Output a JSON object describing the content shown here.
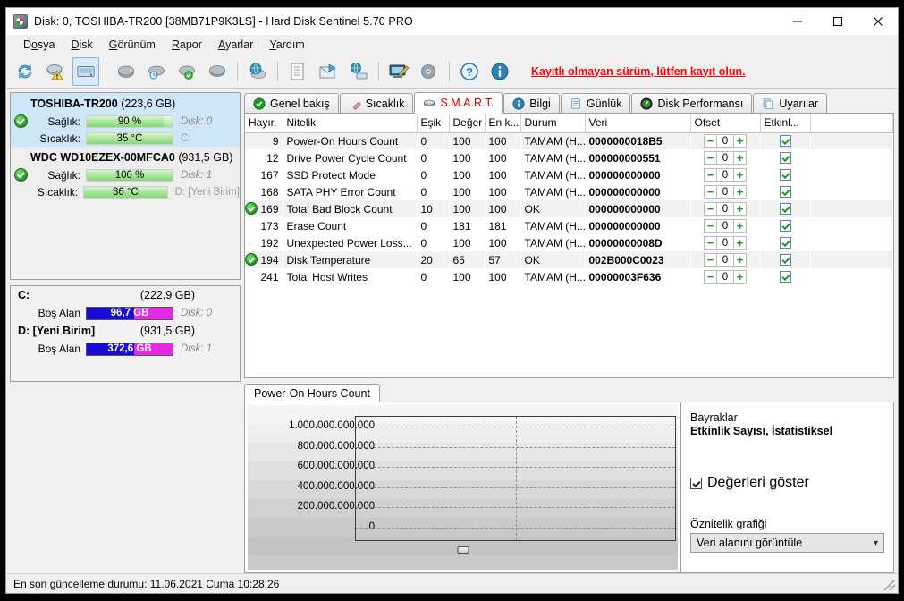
{
  "window": {
    "title": "Disk: 0, TOSHIBA-TR200 [38MB71P9K3LS]  -  Hard Disk Sentinel 5.70 PRO",
    "app_icon": "hard-disk-sentinel-icon",
    "minimize": "–",
    "maximize": "□",
    "close": "✕"
  },
  "menu": [
    {
      "label": "Dosya",
      "accel_index": 1
    },
    {
      "label": "Disk",
      "accel_index": 0
    },
    {
      "label": "Görünüm",
      "accel_index": 0
    },
    {
      "label": "Rapor",
      "accel_index": 0
    },
    {
      "label": "Ayarlar",
      "accel_index": 0
    },
    {
      "label": "Yardım",
      "accel_index": 0
    }
  ],
  "toolbar": {
    "buttons": [
      {
        "name": "refresh-icon"
      },
      {
        "name": "alert-disk-icon"
      },
      {
        "name": "disk-overview-icon",
        "selected": true
      },
      {
        "name": "disk-remove-icon"
      },
      {
        "name": "disk-clock-icon"
      },
      {
        "name": "disk-ok-icon"
      },
      {
        "name": "disk-cloud-icon"
      },
      {
        "name": "disk-globe-icon"
      },
      {
        "name": "report-icon"
      },
      {
        "name": "send-report-icon"
      },
      {
        "name": "network-disk-icon"
      },
      {
        "name": "configure-icon"
      },
      {
        "name": "disk-stack-icon"
      },
      {
        "name": "help-icon"
      },
      {
        "name": "info-icon"
      }
    ],
    "register_link": "Kayıtlı olmayan sürüm, lütfen kayıt olun.",
    "register_link_color": "#ff0000"
  },
  "sidebar": {
    "disks": [
      {
        "model": "TOSHIBA-TR200",
        "capacity": "(223,6 GB)",
        "selected": true,
        "status_icon": "green-check-icon",
        "health_label": "Sağlık:",
        "health_value": "90 %",
        "health_percent": 90,
        "temp_label": "Sıcaklık:",
        "temp_value": "35 °C",
        "temp_percent": 100,
        "disk_id": "Disk: 0",
        "drive_letters": "C:"
      },
      {
        "model": "WDC WD10EZEX-00MFCA0",
        "capacity": "(931,5 GB)",
        "selected": false,
        "status_icon": "green-check-icon",
        "health_label": "Sağlık:",
        "health_value": "100 %",
        "health_percent": 100,
        "temp_label": "Sıcaklık:",
        "temp_value": "36 °C",
        "temp_percent": 100,
        "disk_id": "Disk: 1",
        "drive_letters": "D: [Yeni Birim]"
      }
    ],
    "volumes": [
      {
        "letter": "C:",
        "capacity": "(222,9 GB)",
        "free_label": "Boş Alan",
        "free_value": "96,7 GB",
        "free_percent": 43,
        "disk_id": "Disk: 0"
      },
      {
        "letter": "D: [Yeni Birim]",
        "capacity": "(931,5 GB)",
        "free_label": "Boş Alan",
        "free_value": "372,6 GB",
        "free_percent": 40,
        "disk_id": "Disk: 1"
      }
    ]
  },
  "tabs": [
    {
      "label": "Genel bakış",
      "icon": "green-check-icon",
      "active": false
    },
    {
      "label": "Sıcaklık",
      "icon": "thermometer-icon",
      "active": false
    },
    {
      "label": "S.M.A.R.T.",
      "icon": "smart-chip-icon",
      "active": true
    },
    {
      "label": "Bilgi",
      "icon": "info-icon",
      "active": false
    },
    {
      "label": "Günlük",
      "icon": "log-page-icon",
      "active": false
    },
    {
      "label": "Disk Performansı",
      "icon": "gauge-icon",
      "active": false
    },
    {
      "label": "Uyarılar",
      "icon": "copy-pages-icon",
      "active": false
    }
  ],
  "smart_table": {
    "columns": [
      "Hayır.",
      "Nitelik",
      "Eşik",
      "Değer",
      "En k...",
      "Durum",
      "Veri",
      "Ofset",
      "Etkinl..."
    ],
    "rows": [
      {
        "id": "9",
        "attribute": "Power-On Hours Count",
        "threshold": "0",
        "value": "100",
        "worst": "100",
        "status": "TAMAM (H...",
        "data": "0000000018B5",
        "offset": "0",
        "enabled": true,
        "ok_icon": false
      },
      {
        "id": "12",
        "attribute": "Drive Power Cycle Count",
        "threshold": "0",
        "value": "100",
        "worst": "100",
        "status": "TAMAM (H...",
        "data": "000000000551",
        "offset": "0",
        "enabled": true,
        "ok_icon": false
      },
      {
        "id": "167",
        "attribute": "SSD Protect Mode",
        "threshold": "0",
        "value": "100",
        "worst": "100",
        "status": "TAMAM (H...",
        "data": "000000000000",
        "offset": "0",
        "enabled": true,
        "ok_icon": false
      },
      {
        "id": "168",
        "attribute": "SATA PHY Error Count",
        "threshold": "0",
        "value": "100",
        "worst": "100",
        "status": "TAMAM (H...",
        "data": "000000000000",
        "offset": "0",
        "enabled": true,
        "ok_icon": false
      },
      {
        "id": "169",
        "attribute": "Total Bad Block Count",
        "threshold": "10",
        "value": "100",
        "worst": "100",
        "status": "OK",
        "data": "000000000000",
        "offset": "0",
        "enabled": true,
        "ok_icon": true
      },
      {
        "id": "173",
        "attribute": "Erase Count",
        "threshold": "0",
        "value": "181",
        "worst": "181",
        "status": "TAMAM (H...",
        "data": "000000000000",
        "offset": "0",
        "enabled": true,
        "ok_icon": false
      },
      {
        "id": "192",
        "attribute": "Unexpected Power Loss...",
        "threshold": "0",
        "value": "100",
        "worst": "100",
        "status": "TAMAM (H...",
        "data": "00000000008D",
        "offset": "0",
        "enabled": true,
        "ok_icon": false
      },
      {
        "id": "194",
        "attribute": "Disk Temperature",
        "threshold": "20",
        "value": "65",
        "worst": "57",
        "status": "OK",
        "data": "002B000C0023",
        "offset": "0",
        "enabled": true,
        "ok_icon": true
      },
      {
        "id": "241",
        "attribute": "Total Host Writes",
        "threshold": "0",
        "value": "100",
        "worst": "100",
        "status": "TAMAM (H...",
        "data": "00000003F636",
        "offset": "0",
        "enabled": true,
        "ok_icon": false
      }
    ],
    "spinner_minus": "−",
    "spinner_plus": "+"
  },
  "chart_panel": {
    "tab_label": "Power-On Hours Count",
    "flags_label": "Bayraklar",
    "flags_value": "Etkinlik Sayısı, İstatistiksel",
    "show_values_label": "Değerleri göster",
    "show_values_checked": true,
    "attr_graph_label": "Öznitelik grafiği",
    "combo_value": "Veri alanını görüntüle",
    "combo_arrow": "chevron-down-icon"
  },
  "chart_data": {
    "type": "line",
    "title": "Power-On Hours Count",
    "xlabel": "",
    "ylabel": "",
    "ylim": [
      0,
      1100000000000
    ],
    "yticks": [
      0,
      200000000000,
      400000000000,
      600000000000,
      800000000000,
      1000000000000
    ],
    "ytick_labels": [
      "0",
      "200.000.000.000",
      "400.000.000.000",
      "600.000.000.000",
      "800.000.000.000",
      "1.000.000.000.000"
    ],
    "grid": true,
    "legend": null,
    "series": [
      {
        "name": "Power-On Hours Count",
        "values": []
      }
    ],
    "x": [],
    "note": "No data plotted; empty plot area with dashed gridlines and a vertical cursor line at center."
  },
  "statusbar": {
    "text": "En son güncelleme durumu: 11.06.2021 Cuma 10:28:26"
  }
}
